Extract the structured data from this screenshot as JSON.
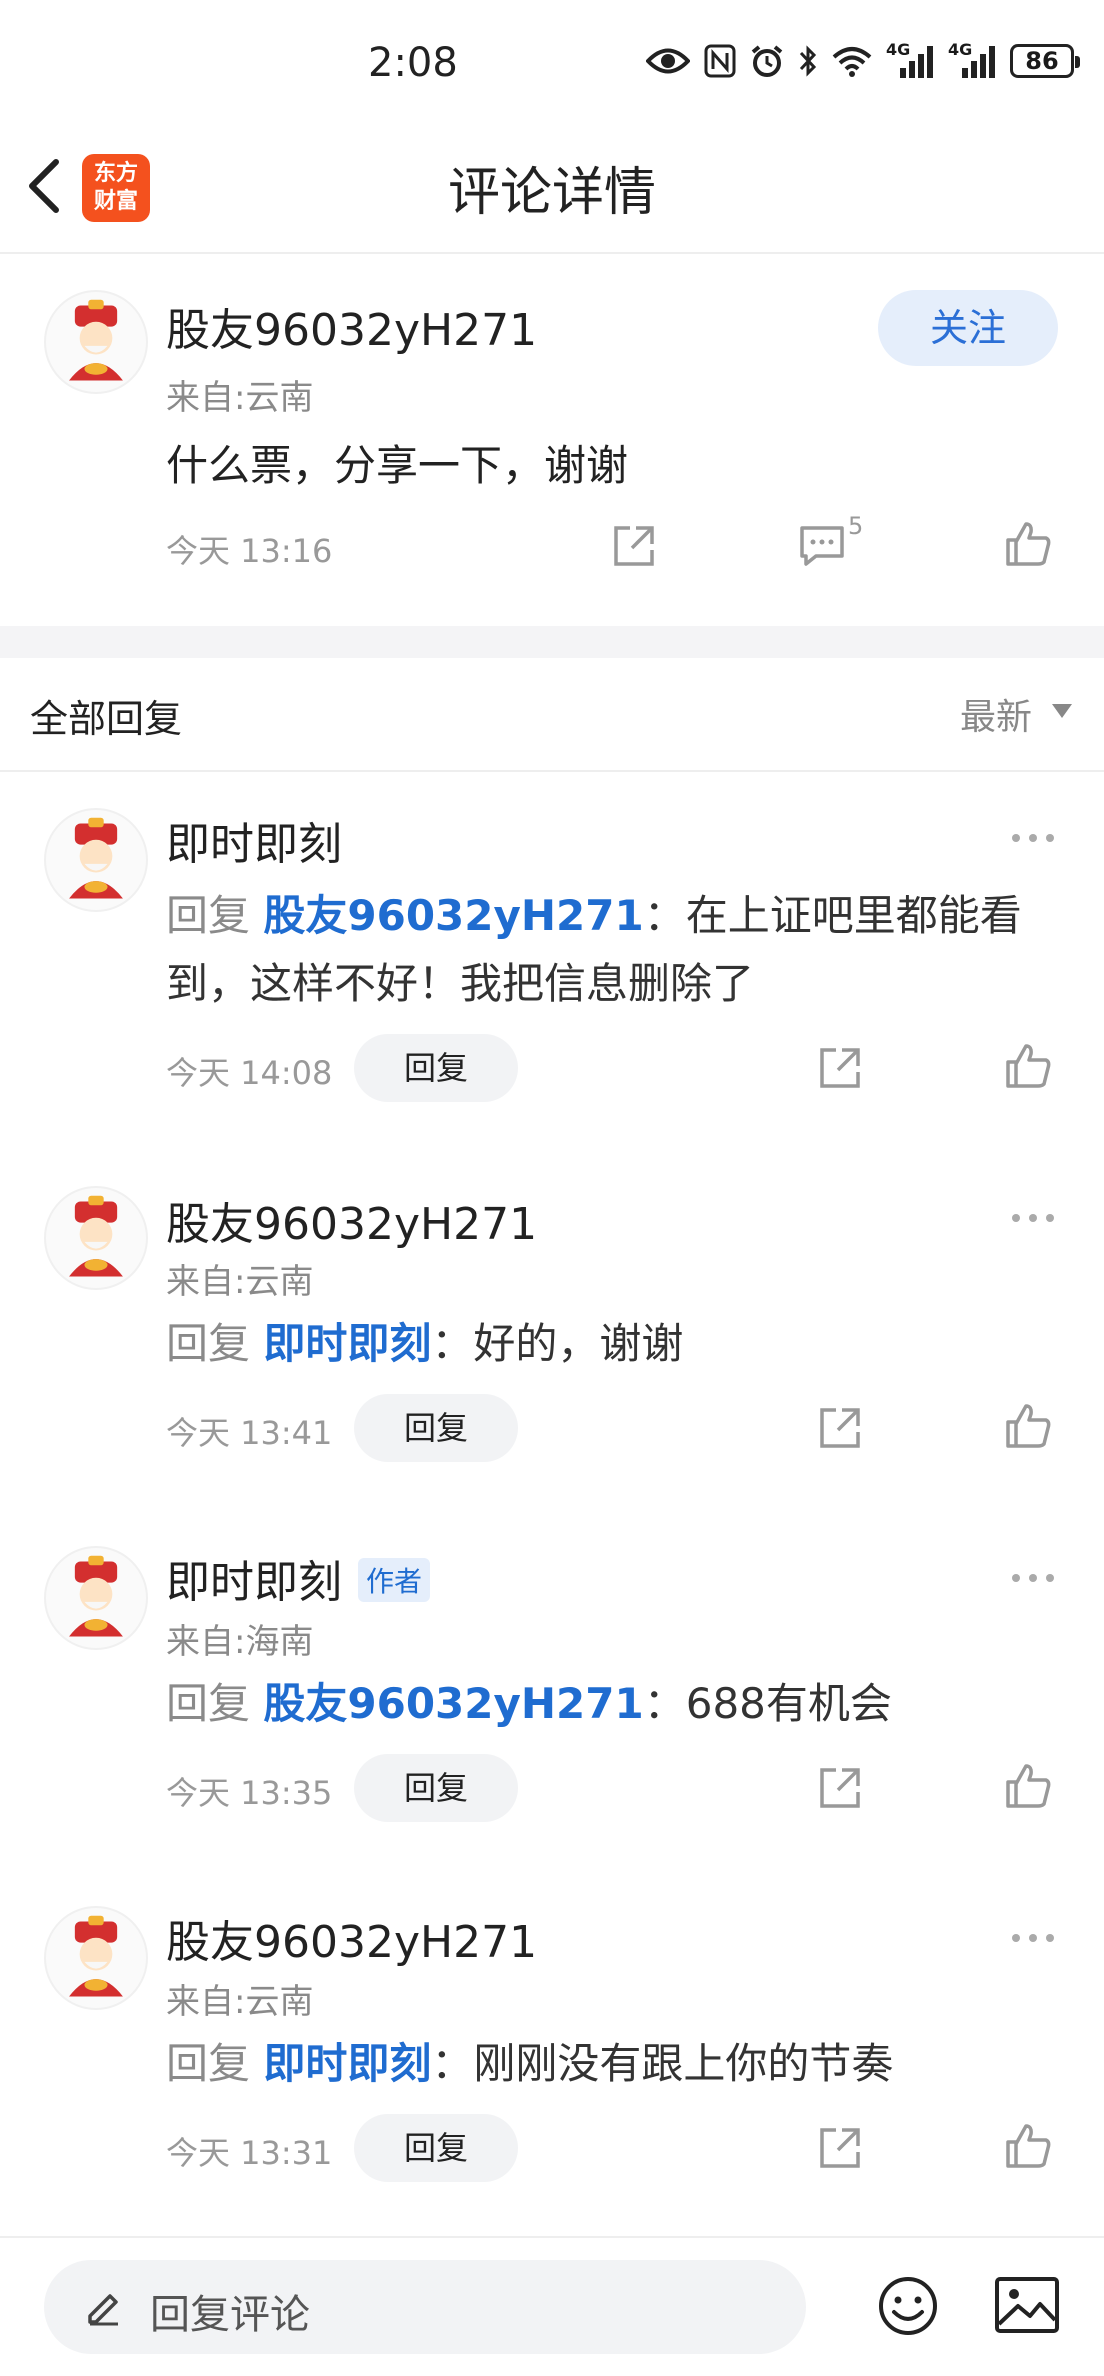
{
  "status_bar": {
    "time": "2:08",
    "battery": "86",
    "net1": "4G",
    "net2": "4G"
  },
  "header": {
    "title": "评论详情",
    "logo_line1": "东方",
    "logo_line2": "财富"
  },
  "main_comment": {
    "username": "股友96032yH271",
    "location": "来自:云南",
    "text": "什么票，分享一下，谢谢",
    "time": "今天 13:16",
    "comment_count": "5",
    "follow_label": "关注"
  },
  "replies_section": {
    "title": "全部回复",
    "sort": "最新"
  },
  "replies": [
    {
      "username": "即时即刻",
      "badge": "",
      "location": "",
      "reply_prefix": "回复",
      "mention": "股友96032yH271",
      "separator": "：",
      "text_line1": "在上证吧里都能看",
      "text_line2": "到，这样不好！我把信息删除了",
      "time": "今天 14:08",
      "reply_button": "回复"
    },
    {
      "username": "股友96032yH271",
      "badge": "",
      "location": "来自:云南",
      "reply_prefix": "回复",
      "mention": "即时即刻",
      "separator": "：",
      "text_line1": "好的，谢谢",
      "text_line2": "",
      "time": "今天 13:41",
      "reply_button": "回复"
    },
    {
      "username": "即时即刻",
      "badge": "作者",
      "location": "来自:海南",
      "reply_prefix": "回复",
      "mention": "股友96032yH271",
      "separator": "：",
      "text_line1": "688有机会",
      "text_line2": "",
      "time": "今天 13:35",
      "reply_button": "回复"
    },
    {
      "username": "股友96032yH271",
      "badge": "",
      "location": "来自:云南",
      "reply_prefix": "回复",
      "mention": "即时即刻",
      "separator": "：",
      "text_line1": "刚刚没有跟上你的节奏",
      "text_line2": "",
      "time": "今天 13:31",
      "reply_button": "回复"
    }
  ],
  "bottom_bar": {
    "placeholder": "回复评论"
  },
  "colors": {
    "accent": "#1f6cd0",
    "logo": "#f4511e",
    "follow_bg": "#e5eefb"
  }
}
